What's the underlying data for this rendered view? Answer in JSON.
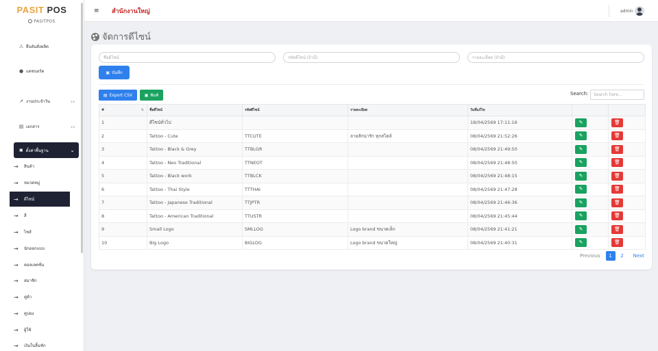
{
  "brand": {
    "part1": "PASIT",
    "part2": "POS",
    "sub": "PASITPOS"
  },
  "sidebar": {
    "items": [
      {
        "label": "ยืนยันสั่งผลิต",
        "icon": "warning-icon"
      },
      {
        "label": "แดชบอร์ด",
        "icon": "info-icon"
      },
      {
        "label": "งานประจำวัน",
        "icon": "trend-icon",
        "has_chevron": true
      },
      {
        "label": "เอกสาร",
        "icon": "document-icon",
        "has_chevron": true
      }
    ],
    "active_group": {
      "label": "ตั้งค่าพื้นฐาน",
      "icon": "printer-icon"
    },
    "sub_items": [
      "สินค้า",
      "หมวดหมู่",
      "ดีไซน์",
      "สี",
      "ไซส์",
      "นักออกแบบ",
      "คอลเลคชั่น",
      "สมาชิก",
      "คู่ค้า",
      "คูปอง",
      "ผู้ใช้",
      "เงินในลิ้นชัก"
    ],
    "active_sub_index": 2
  },
  "header": {
    "menu_icon": "≡",
    "branch": "สำนักงานใหญ่",
    "user": "admin"
  },
  "page": {
    "title": "จัดการดีไซน์"
  },
  "form": {
    "name_placeholder": "ชื่อดีไซน์",
    "code_placeholder": "รหัสดีไซน์ (ถ้ามี)",
    "detail_placeholder": "รายละเอียด (ถ้ามี)",
    "save_label": "บันทึก"
  },
  "toolbar": {
    "csv_label": "Export CSV",
    "print_label": "พิมพ์",
    "search_label": "Search:",
    "search_placeholder": "Search here..."
  },
  "table": {
    "headers": [
      "#",
      "ชื่อดีไซน์",
      "รหัสดีไซน์",
      "รายละเอียด",
      "วันที่แก้ไข",
      "",
      ""
    ],
    "rows": [
      [
        "1",
        "ดีไซน์ทั่วไป",
        "",
        "",
        "18/04/2569 17:11:16"
      ],
      [
        "2",
        "Tattoo - Cute",
        "TTCUTE",
        "ลายสักน่ารัก ทุกสไตล์",
        "08/04/2569 21:52:26"
      ],
      [
        "3",
        "Tattoo - Black & Grey",
        "TTBLGR",
        "",
        "08/04/2569 21:49:50"
      ],
      [
        "4",
        "Tattoo - Neo Traditional",
        "TTNEOT",
        "",
        "08/04/2569 21:48:50"
      ],
      [
        "5",
        "Tattoo - Black work",
        "TTBLCK",
        "",
        "08/04/2569 21:48:15"
      ],
      [
        "6",
        "Tattoo - Thai Style",
        "TTTHAI",
        "",
        "08/04/2569 21:47:28"
      ],
      [
        "7",
        "Tattoo - Japanese Traditional",
        "TTJPTR",
        "",
        "08/04/2569 21:46:36"
      ],
      [
        "8",
        "Tattoo - American Traditional",
        "TTUSTR",
        "",
        "08/04/2569 21:45:44"
      ],
      [
        "9",
        "Small Logo",
        "SMLLOG",
        "Logo brand ขนาดเล็ก",
        "08/04/2569 21:41:21"
      ],
      [
        "10",
        "Big Logo",
        "BIGLOG",
        "Logo brand ขนาดใหญ่",
        "08/04/2569 21:40:31"
      ]
    ]
  },
  "pagination": {
    "prev": "Previous",
    "pages": [
      "1",
      "2"
    ],
    "current": "1",
    "next": "Next"
  },
  "colors": {
    "accent": "#2f80ed",
    "success": "#1aa260",
    "danger": "#e53935",
    "nav_dark": "#1e2233",
    "brand_orange": "#e8a33d",
    "branch_red": "#c62828"
  }
}
